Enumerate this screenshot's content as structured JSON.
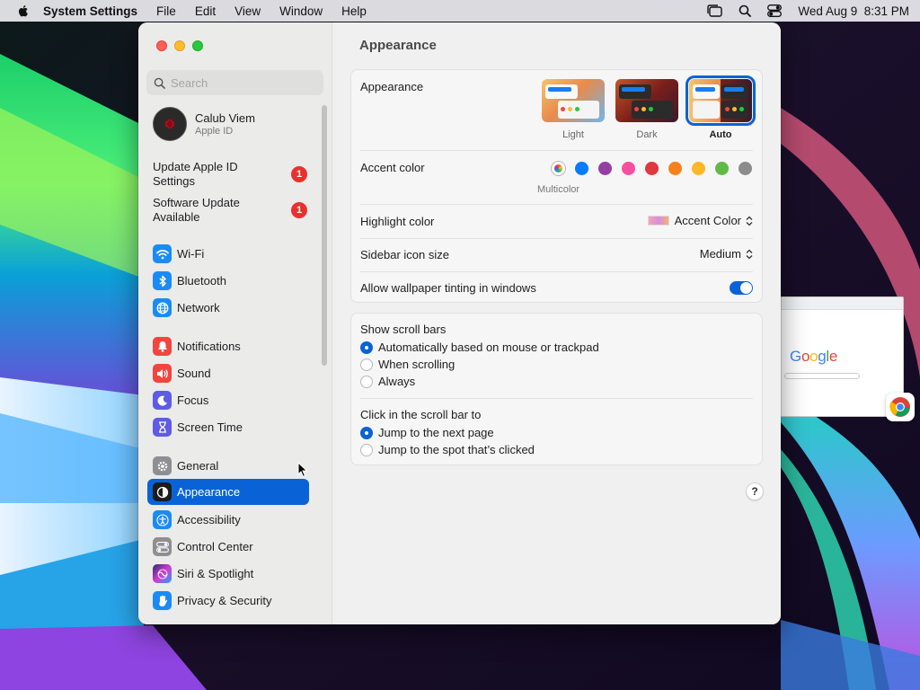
{
  "menubar": {
    "app_name": "System Settings",
    "menus": [
      "File",
      "Edit",
      "View",
      "Window",
      "Help"
    ],
    "clock": "Wed Aug 9  8:31 PM"
  },
  "sidebar": {
    "search_placeholder": "Search",
    "account": {
      "name": "Calub Viem",
      "subtitle": "Apple ID"
    },
    "notices": [
      {
        "label": "Update Apple ID Settings",
        "badge": "1"
      },
      {
        "label": "Software Update Available",
        "badge": "1"
      }
    ],
    "items": [
      {
        "label": "Wi-Fi",
        "icon": "wifi-icon"
      },
      {
        "label": "Bluetooth",
        "icon": "bluetooth-icon"
      },
      {
        "label": "Network",
        "icon": "network-icon"
      },
      {
        "label": "Notifications",
        "icon": "notifications-icon"
      },
      {
        "label": "Sound",
        "icon": "sound-icon"
      },
      {
        "label": "Focus",
        "icon": "focus-icon"
      },
      {
        "label": "Screen Time",
        "icon": "hourglass-icon"
      },
      {
        "label": "General",
        "icon": "gear-icon"
      },
      {
        "label": "Appearance",
        "icon": "appearance-icon",
        "selected": true
      },
      {
        "label": "Accessibility",
        "icon": "accessibility-icon"
      },
      {
        "label": "Control Center",
        "icon": "control-center-icon"
      },
      {
        "label": "Siri & Spotlight",
        "icon": "siri-icon"
      },
      {
        "label": "Privacy & Security",
        "icon": "hand-icon"
      }
    ]
  },
  "main": {
    "title": "Appearance",
    "appearance": {
      "label": "Appearance",
      "options": [
        "Light",
        "Dark",
        "Auto"
      ],
      "selected": "Auto"
    },
    "accent": {
      "label": "Accent color",
      "selected_label": "Multicolor",
      "colors": [
        "#0a7aff",
        "#953fa5",
        "#f74f9e",
        "#e0383e",
        "#f7821b",
        "#fcb827",
        "#62ba46",
        "#8c8c8c"
      ]
    },
    "highlight": {
      "label": "Highlight color",
      "value": "Accent Color"
    },
    "sidebar_icon_size": {
      "label": "Sidebar icon size",
      "value": "Medium"
    },
    "wallpaper_tinting": {
      "label": "Allow wallpaper tinting in windows",
      "enabled": true
    },
    "scroll_bars": {
      "label": "Show scroll bars",
      "options": [
        "Automatically based on mouse or trackpad",
        "When scrolling",
        "Always"
      ],
      "selected": "Automatically based on mouse or trackpad"
    },
    "click_scroll": {
      "label": "Click in the scroll bar to",
      "options": [
        "Jump to the next page",
        "Jump to the spot that’s clicked"
      ],
      "selected": "Jump to the next page"
    },
    "help_label": "?"
  },
  "background_window": {
    "logo_text": "Google"
  }
}
